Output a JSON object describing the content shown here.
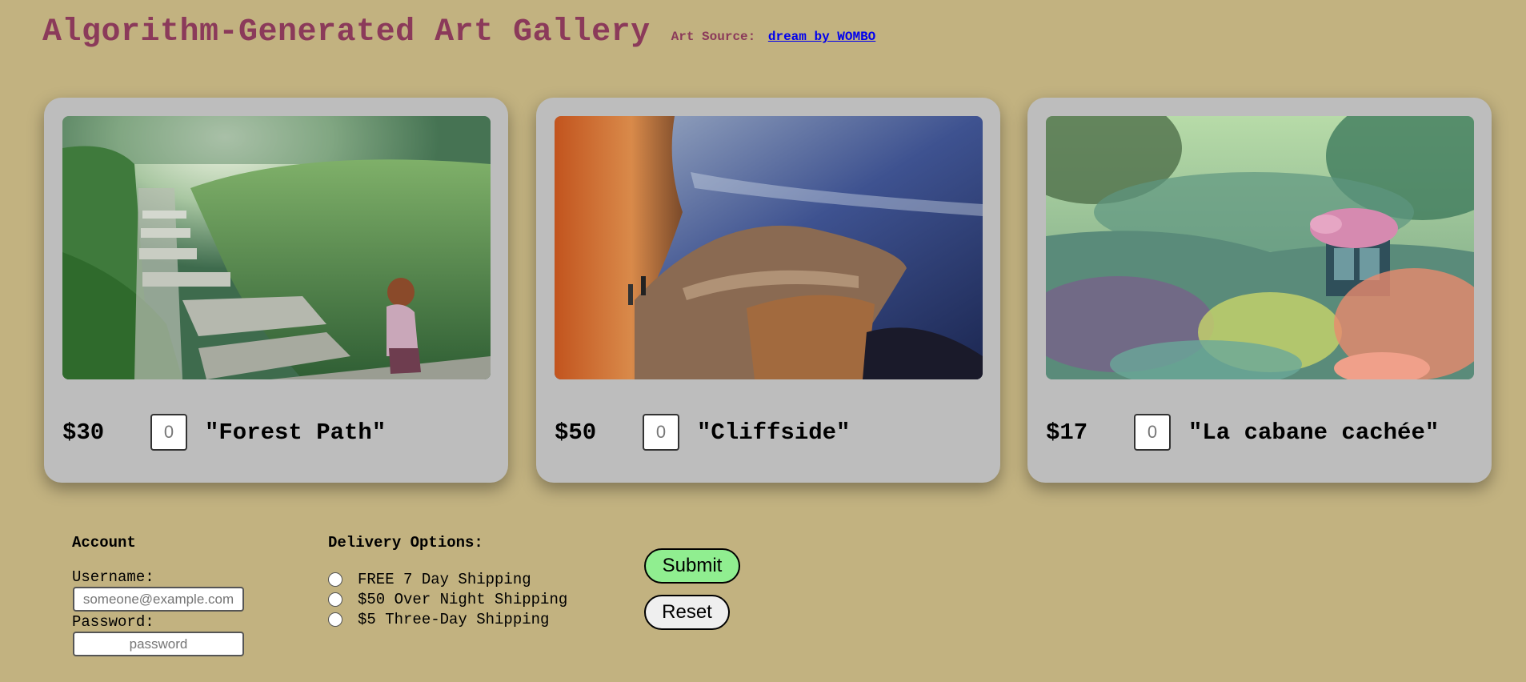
{
  "header": {
    "title": "Algorithm-Generated Art Gallery",
    "source_label": "Art Source:",
    "source_link": "dream by WOMBO"
  },
  "artworks": [
    {
      "price": "$30",
      "quantity": "0",
      "name": "\"Forest Path\""
    },
    {
      "price": "$50",
      "quantity": "0",
      "name": "\"Cliffside\""
    },
    {
      "price": "$17",
      "quantity": "0",
      "name": "\"La cabane cachée\""
    }
  ],
  "account": {
    "heading": "Account",
    "username_label": "Username:",
    "username_placeholder": "someone@example.com",
    "password_label": "Password:",
    "password_placeholder": "password"
  },
  "delivery": {
    "heading": "Delivery Options:",
    "options": [
      "FREE 7 Day Shipping",
      "$50 Over Night Shipping",
      "$5 Three-Day Shipping"
    ]
  },
  "buttons": {
    "submit": "Submit",
    "reset": "Reset"
  },
  "colors": {
    "background": "#c2b280",
    "title": "#8b3a5a",
    "submit_bg": "#90ee90",
    "reset_bg": "#efefef",
    "card": "#bdbdbd"
  }
}
